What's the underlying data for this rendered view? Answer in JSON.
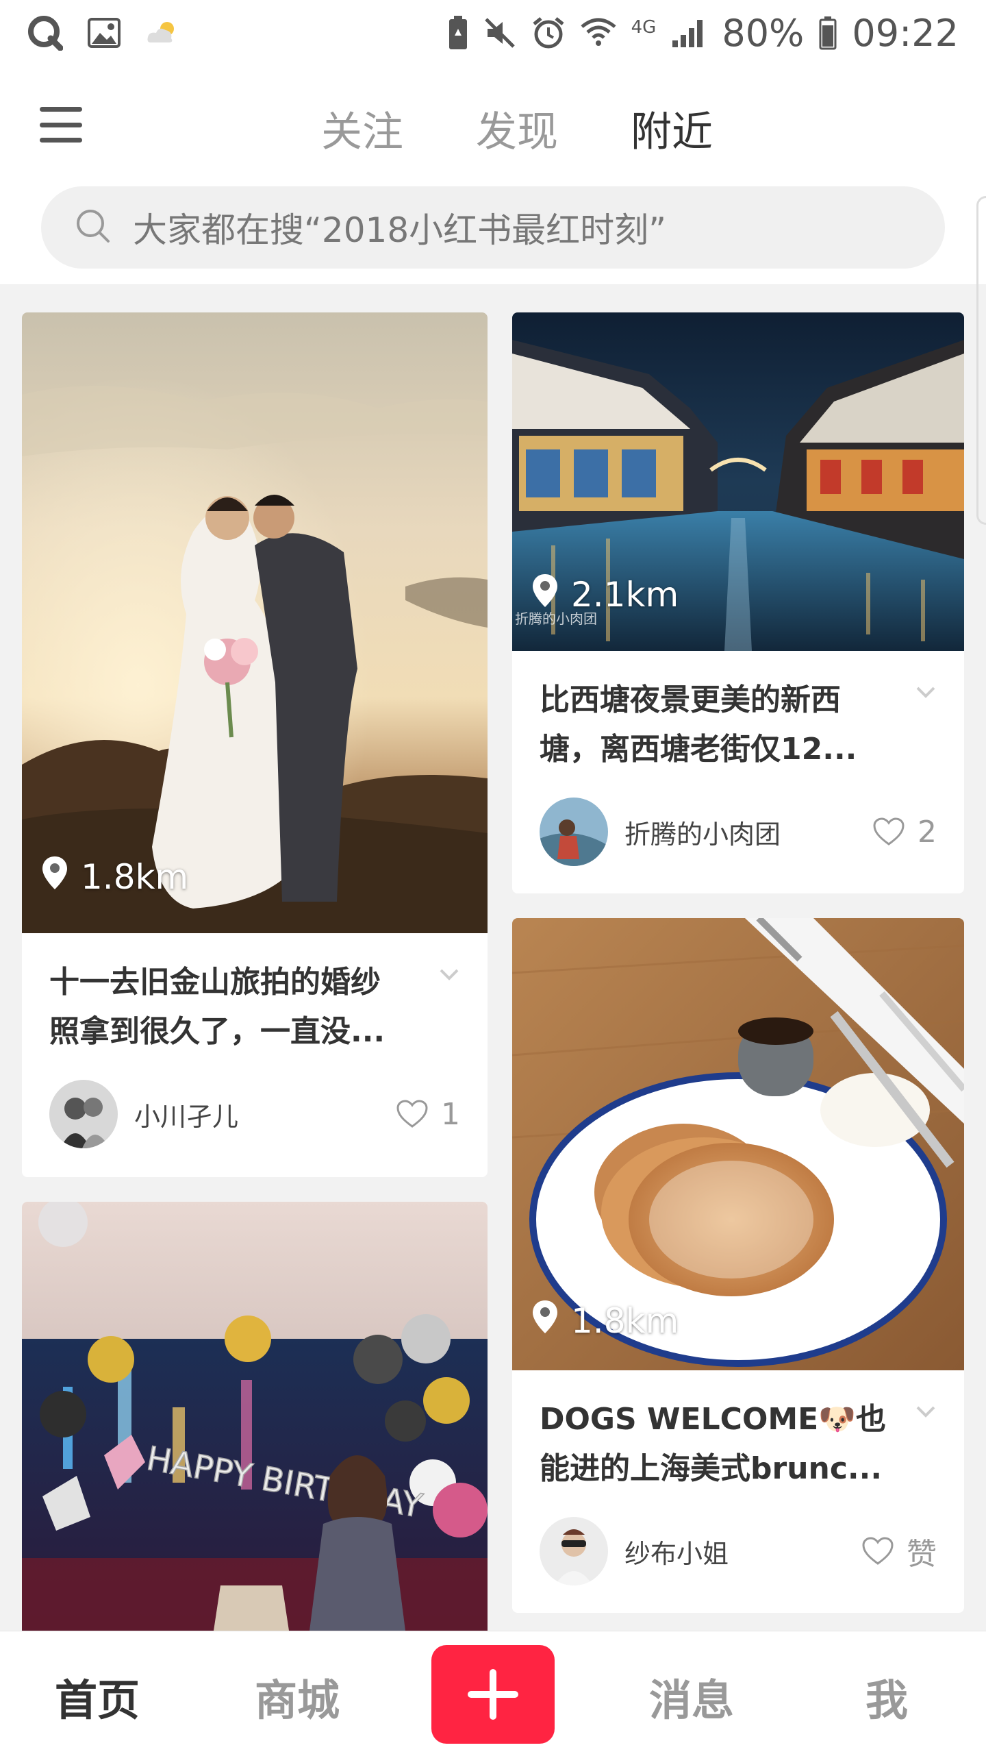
{
  "status_bar": {
    "battery": "80%",
    "time": "09:22",
    "network": "4G",
    "icons": [
      "q-app-icon",
      "gallery-icon",
      "weather-icon",
      "battery-saver-icon",
      "mute-icon",
      "alarm-icon",
      "wifi-icon",
      "signal-icon",
      "battery-icon"
    ]
  },
  "header": {
    "tabs": [
      {
        "label": "关注"
      },
      {
        "label": "发现"
      },
      {
        "label": "附近"
      }
    ],
    "active_tab": "附近"
  },
  "search": {
    "placeholder": "大家都在搜“2018小红书最红时刻”"
  },
  "feed": {
    "cards": [
      {
        "distance": "1.8km",
        "title": "十一去旧金山旅拍的婚纱照拿到很久了，一直没...",
        "author": "小川孑儿",
        "likes": "1"
      },
      {
        "distance": "2.1km",
        "watermark": "折腾的小肉团",
        "title": "比西塘夜景更美的新西塘，离西塘老街仅12...",
        "author": "折腾的小肉团",
        "likes": "2"
      },
      {
        "distance": "1.8km",
        "title": "DOGS WELCOME🐶也能进的上海美式brunc...",
        "author": "纱布小姐",
        "likes": "赞"
      },
      {
        "balloon_text": "HAPPY BIRTHDAY"
      }
    ]
  },
  "bottom_nav": {
    "items": [
      {
        "label": "首页"
      },
      {
        "label": "商城"
      },
      {
        "label": "消息"
      },
      {
        "label": "我"
      }
    ],
    "active": "首页"
  },
  "colors": {
    "accent": "#ff2442",
    "text_primary": "#333333",
    "text_secondary": "#999999"
  }
}
